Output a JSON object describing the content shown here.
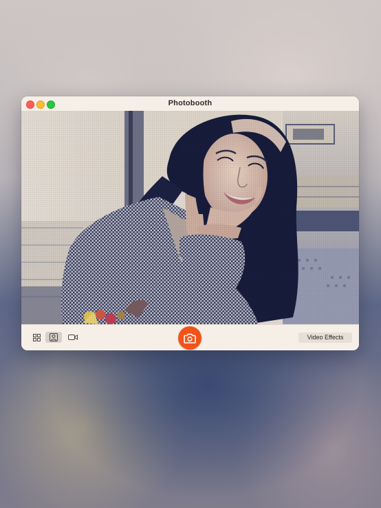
{
  "window": {
    "title": "Photobooth"
  },
  "toolbar": {
    "modes": [
      {
        "icon": "grid-icon",
        "selected": false
      },
      {
        "icon": "person-icon",
        "selected": true
      },
      {
        "icon": "video-camera-icon",
        "selected": false
      }
    ],
    "shutter_icon": "camera-icon",
    "effects_label": "Video Effects"
  },
  "colors": {
    "accent": "#f25319",
    "window_bg": "#f6efe7",
    "close": "#ff5f57",
    "minimize": "#febc2e",
    "maximize": "#28c840"
  }
}
